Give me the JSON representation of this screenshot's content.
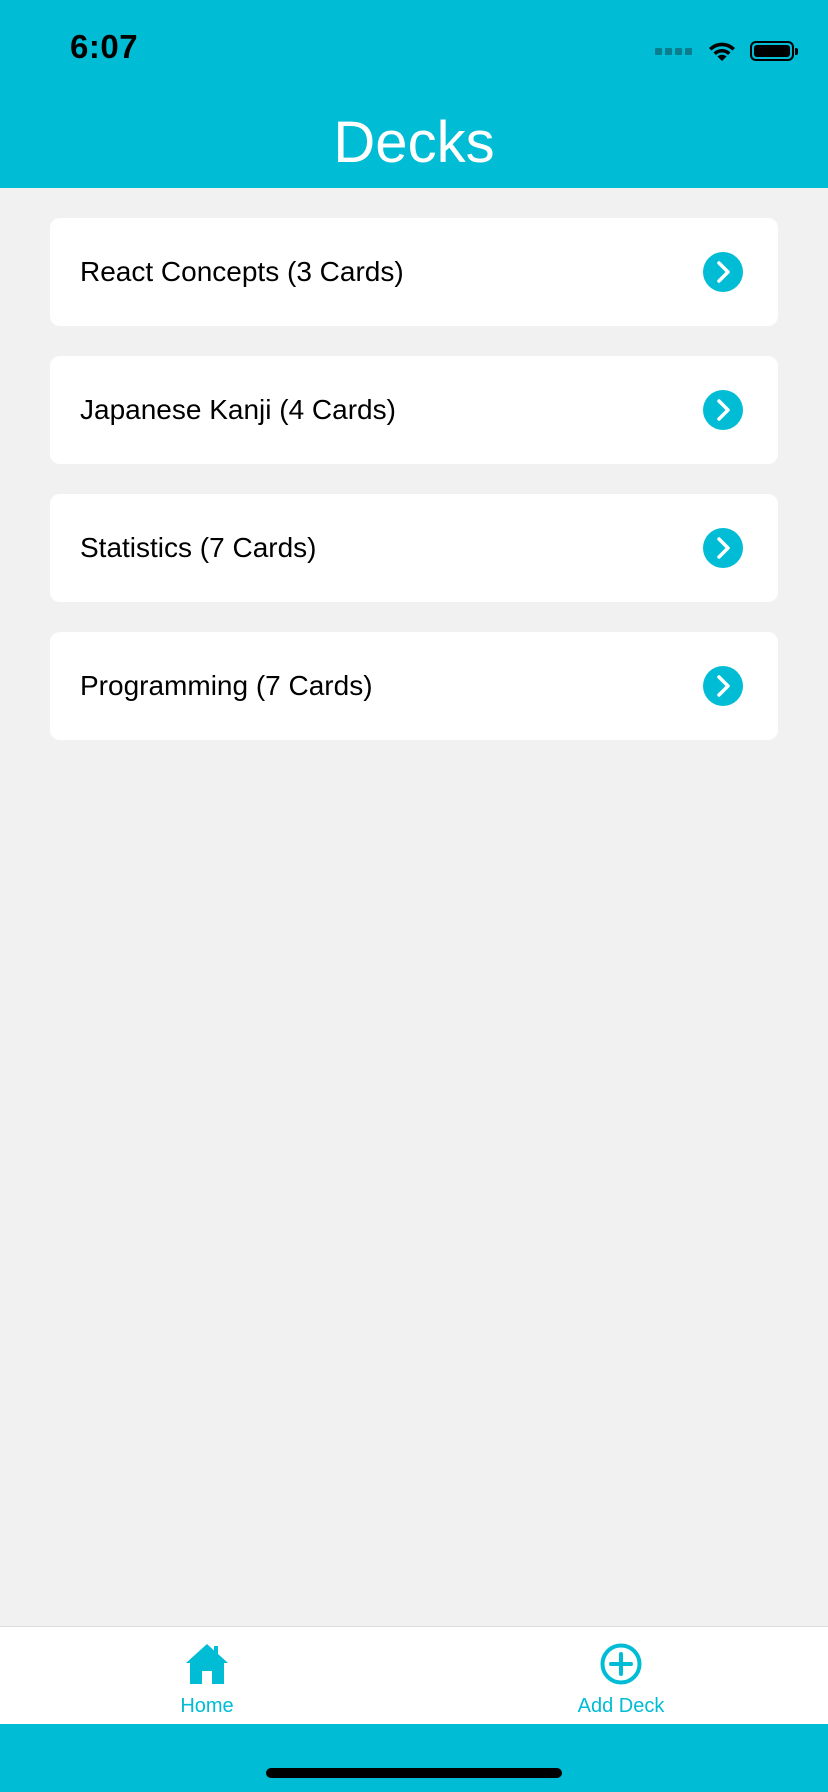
{
  "status_bar": {
    "time": "6:07"
  },
  "header": {
    "title": "Decks"
  },
  "decks": [
    {
      "label": "React Concepts (3 Cards)",
      "icon": "chevron-right-circle-icon"
    },
    {
      "label": "Japanese Kanji (4 Cards)",
      "icon": "chevron-right-circle-icon"
    },
    {
      "label": "Statistics (7 Cards)",
      "icon": "chevron-right-circle-icon"
    },
    {
      "label": "Programming (7 Cards)",
      "icon": "chevron-right-circle-icon"
    }
  ],
  "tabbar": {
    "home": {
      "label": "Home",
      "icon": "home-icon"
    },
    "add_deck": {
      "label": "Add Deck",
      "icon": "plus-circle-icon"
    }
  },
  "colors": {
    "accent": "#00bcd4",
    "background": "#f1f1f1",
    "card": "#ffffff"
  }
}
